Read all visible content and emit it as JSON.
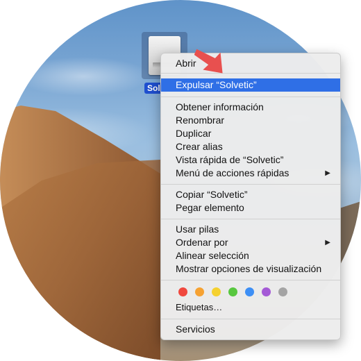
{
  "desktop": {
    "drive_label": "Sol"
  },
  "context_menu": {
    "open": "Abrir",
    "eject": "Expulsar “Solvetic”",
    "get_info": "Obtener información",
    "rename": "Renombrar",
    "duplicate": "Duplicar",
    "make_alias": "Crear alias",
    "quick_look": "Vista rápida de “Solvetic”",
    "quick_actions": "Menú de acciones rápidas",
    "copy": "Copiar “Solvetic”",
    "paste": "Pegar elemento",
    "use_stacks": "Usar pilas",
    "sort_by": "Ordenar por",
    "align": "Alinear selección",
    "view_options": "Mostrar opciones de visualización",
    "tags_label": "Etiquetas…",
    "services": "Servicios",
    "submenu_arrow": "▶",
    "highlighted_item": "eject",
    "tag_colors": [
      {
        "name": "red-tag",
        "color": "#f0483e"
      },
      {
        "name": "orange-tag",
        "color": "#f6a232"
      },
      {
        "name": "yellow-tag",
        "color": "#f5d12f"
      },
      {
        "name": "green-tag",
        "color": "#58c73f"
      },
      {
        "name": "blue-tag",
        "color": "#3d8ff5"
      },
      {
        "name": "purple-tag",
        "color": "#a45ad6"
      },
      {
        "name": "gray-tag",
        "color": "#a4a4a4"
      }
    ]
  },
  "colors": {
    "highlight": "#2f6fe6",
    "pointer": "#e8504f"
  }
}
